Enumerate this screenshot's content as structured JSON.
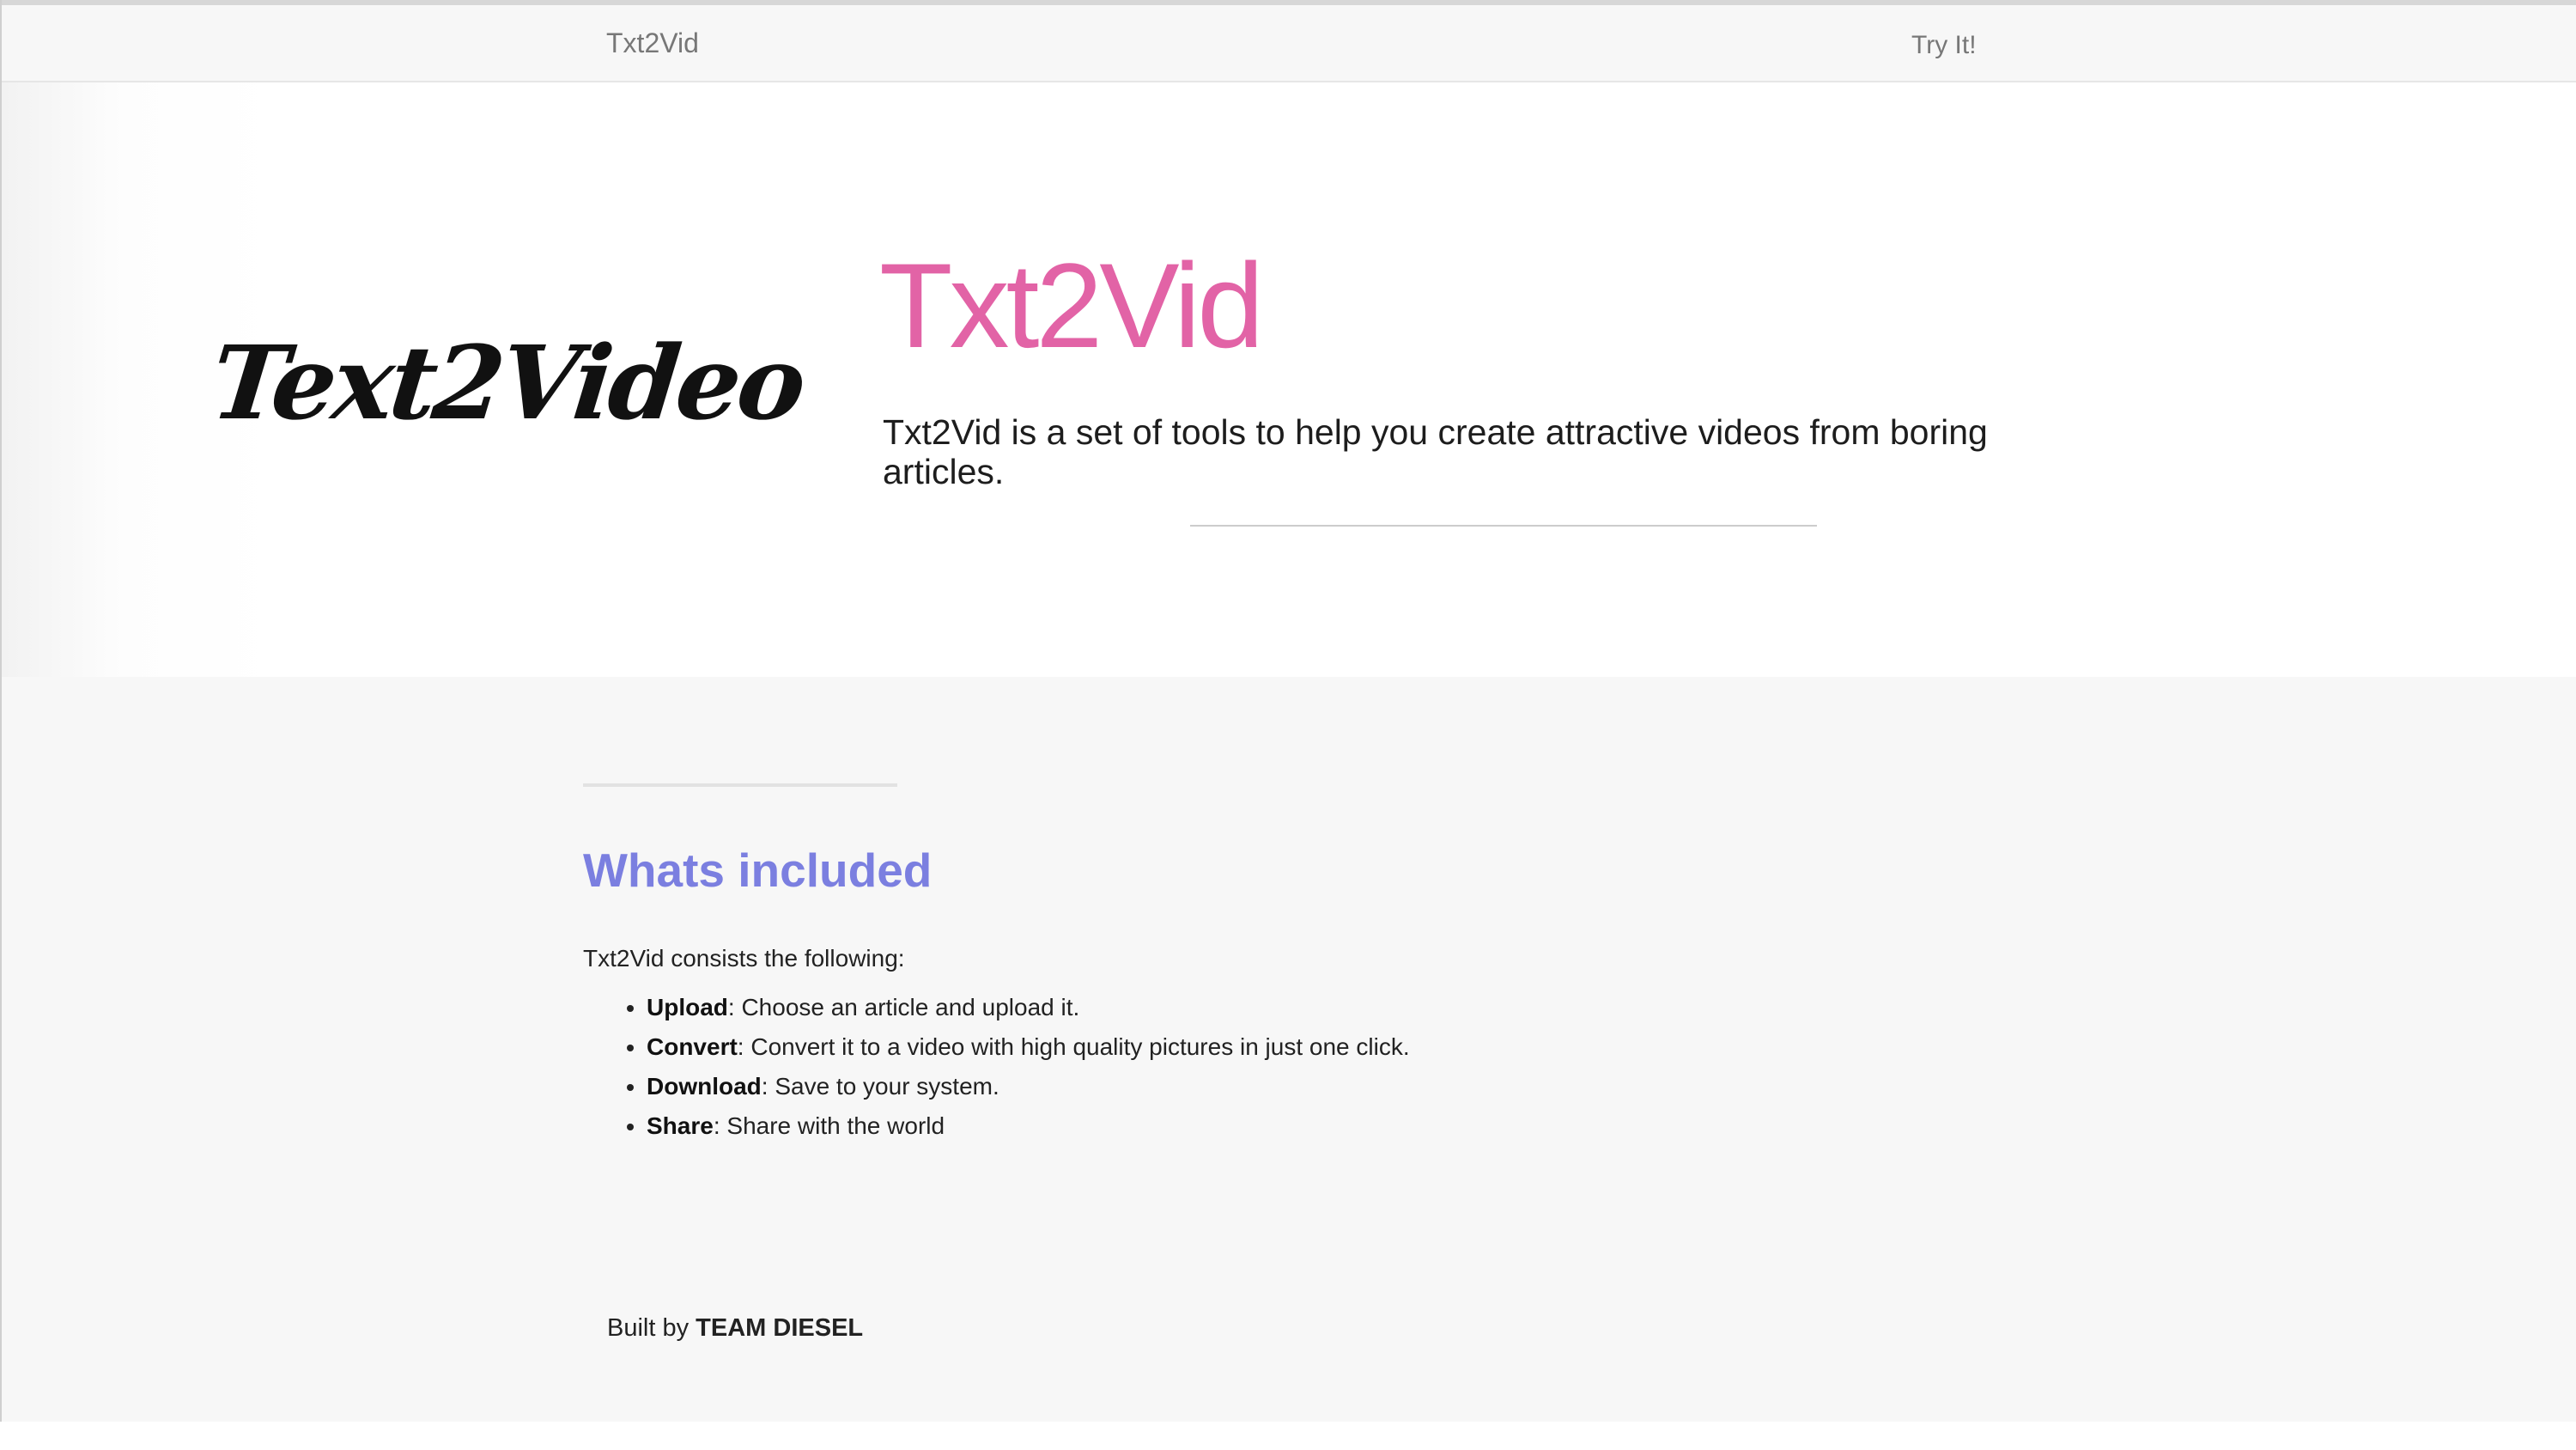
{
  "navbar": {
    "brand": "Txt2Vid",
    "try_link": "Try It!"
  },
  "hero": {
    "logo_text": "Text2Video",
    "title": "Txt2Vid",
    "lead": "Txt2Vid is a set of tools to help you create attractive videos from boring articles."
  },
  "included": {
    "heading": "Whats included",
    "intro": "Txt2Vid consists the following:",
    "items": [
      {
        "name": "Upload",
        "desc": ": Choose an article and upload it."
      },
      {
        "name": "Convert",
        "desc": ": Convert it to a video with high quality pictures in just one click."
      },
      {
        "name": "Download",
        "desc": ": Save to your system."
      },
      {
        "name": "Share",
        "desc": ": Share with the world"
      }
    ]
  },
  "footer": {
    "prefix": "Built by ",
    "team": "TEAM DIESEL"
  },
  "colors": {
    "hero_title": "#e0569f",
    "section_heading": "#7b7fe0",
    "nav_text": "#777777",
    "content_bg": "#f7f7f7"
  }
}
